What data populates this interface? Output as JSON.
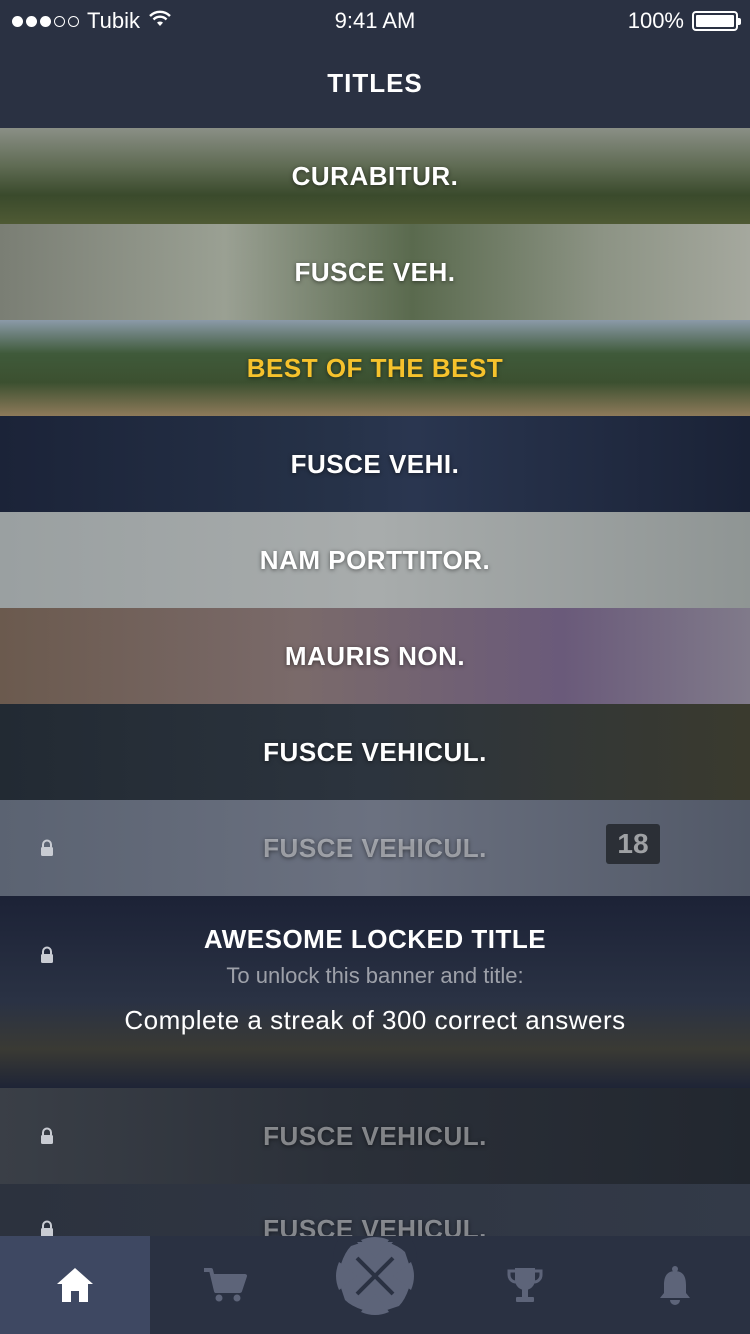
{
  "status_bar": {
    "carrier": "Tubik",
    "time": "9:41 AM",
    "battery": "100%"
  },
  "header": {
    "title": "TITLES"
  },
  "titles": [
    {
      "label": "CURABITUR.",
      "state": "unlocked"
    },
    {
      "label": "FUSCE VEH.",
      "state": "unlocked"
    },
    {
      "label": "BEST OF THE BEST",
      "state": "selected"
    },
    {
      "label": "FUSCE VEHI.",
      "state": "unlocked"
    },
    {
      "label": "NAM PORTTITOR.",
      "state": "unlocked"
    },
    {
      "label": "MAURIS NON.",
      "state": "unlocked"
    },
    {
      "label": "FUSCE VEHICUL.",
      "state": "unlocked"
    },
    {
      "label": "FUSCE VEHICUL.",
      "state": "locked",
      "badge": "18"
    },
    {
      "label": "AWESOME LOCKED TITLE",
      "state": "locked-expanded",
      "subtitle": "To unlock this banner and title:",
      "goal": "Complete a streak of 300 correct answers"
    },
    {
      "label": "FUSCE VEHICUL.",
      "state": "locked"
    },
    {
      "label": "FUSCE VEHICUL.",
      "state": "locked"
    }
  ],
  "tab_bar": {
    "items": [
      {
        "icon": "home-icon",
        "active": true
      },
      {
        "icon": "cart-icon",
        "active": false
      },
      {
        "icon": "center-logo-icon",
        "active": false
      },
      {
        "icon": "trophy-icon",
        "active": false
      },
      {
        "icon": "bell-icon",
        "active": false
      }
    ]
  },
  "colors": {
    "background": "#2a3142",
    "active_tab": "#3e4862",
    "highlight": "#f6c22c",
    "icon_inactive": "#5d6479"
  }
}
